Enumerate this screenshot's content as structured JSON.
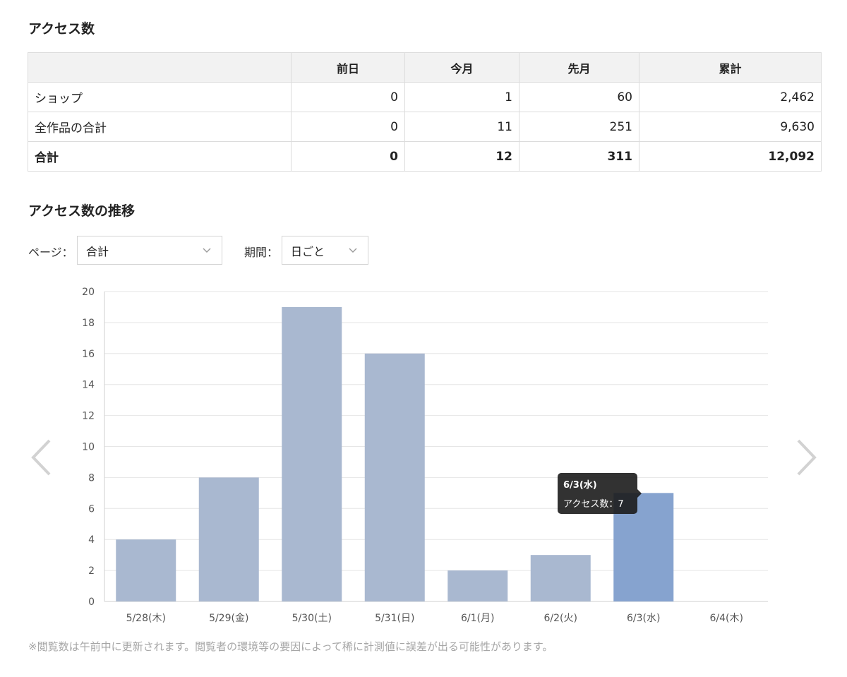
{
  "access": {
    "title": "アクセス数",
    "columns": [
      "",
      "前日",
      "今月",
      "先月",
      "累計"
    ],
    "rows": [
      {
        "label": "ショップ",
        "values": [
          "0",
          "1",
          "60",
          "2,462"
        ],
        "bold": false
      },
      {
        "label": "全作品の合計",
        "values": [
          "0",
          "11",
          "251",
          "9,630"
        ],
        "bold": false
      },
      {
        "label": "合計",
        "values": [
          "0",
          "12",
          "311",
          "12,092"
        ],
        "bold": true
      }
    ]
  },
  "trend": {
    "title": "アクセス数の推移",
    "page_label": "ページ：",
    "page_value": "合計",
    "period_label": "期間：",
    "period_value": "日ごと"
  },
  "tooltip": {
    "title": "6/3(水)",
    "body": "アクセス数：7"
  },
  "note": "※閲覧数は午前中に更新されます。閲覧者の環境等の要因によって稀に計測値に誤差が出る可能性があります。",
  "icons": {
    "prev": "chevron-left-icon",
    "next": "chevron-right-icon",
    "dropdown": "chevron-down-icon"
  },
  "colors": {
    "bar": "#a9b8d0",
    "bar_active": "#86a3cf",
    "grid": "#e6e6e6"
  },
  "chart_data": {
    "type": "bar",
    "categories": [
      "5/28(木)",
      "5/29(金)",
      "5/30(土)",
      "5/31(日)",
      "6/1(月)",
      "6/2(火)",
      "6/3(水)",
      "6/4(木)"
    ],
    "series": [
      {
        "values": [
          4,
          8,
          19,
          16,
          2,
          3,
          7,
          0
        ]
      }
    ],
    "ylim": [
      0,
      20
    ],
    "yticks": [
      0,
      2,
      4,
      6,
      8,
      10,
      12,
      14,
      16,
      18,
      20
    ],
    "highlighted_index": 6,
    "grid": true,
    "legend": "none"
  }
}
